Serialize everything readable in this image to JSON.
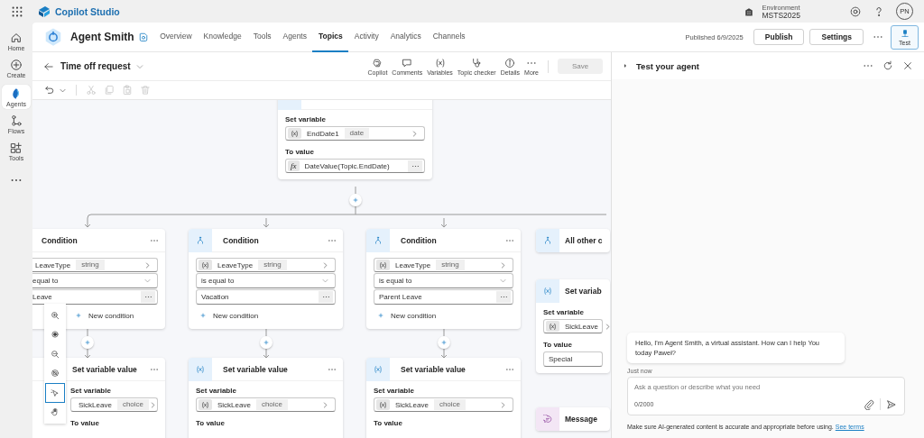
{
  "top_bar": {
    "app_name": "Copilot Studio",
    "environment_label": "Environment",
    "environment": "MSTS2025",
    "avatar": "PN"
  },
  "rail": [
    {
      "kind": "home",
      "label": "Home",
      "selected": false
    },
    {
      "kind": "create",
      "label": "Create",
      "selected": false
    },
    {
      "kind": "agents",
      "label": "Agents",
      "selected": true
    },
    {
      "kind": "flows",
      "label": "Flows",
      "selected": false
    },
    {
      "kind": "tools",
      "label": "Tools",
      "selected": false
    },
    {
      "kind": "more"
    }
  ],
  "agent": {
    "name": "Agent Smith"
  },
  "tabs": [
    {
      "label": "Overview",
      "selected": false
    },
    {
      "label": "Knowledge",
      "selected": false
    },
    {
      "label": "Tools",
      "selected": false
    },
    {
      "label": "Agents",
      "selected": false
    },
    {
      "label": "Topics",
      "selected": true
    },
    {
      "label": "Activity",
      "selected": false
    },
    {
      "label": "Analytics",
      "selected": false
    },
    {
      "label": "Channels",
      "selected": false
    }
  ],
  "published": "Published 6/9/2025",
  "header_buttons": [
    {
      "label": "Publish"
    },
    {
      "label": "Settings"
    }
  ],
  "test_button": {
    "label": "Test",
    "selected": true
  },
  "topic": {
    "title": "Time off request"
  },
  "topic_tools": [
    {
      "kind": "copilot",
      "label": "Copilot"
    },
    {
      "kind": "comments",
      "label": "Comments"
    },
    {
      "kind": "variables",
      "label": "Variables"
    },
    {
      "kind": "checker",
      "label": "Topic checker"
    },
    {
      "kind": "details",
      "label": "Details"
    },
    {
      "kind": "more",
      "label": "More"
    }
  ],
  "save": {
    "label": "Save",
    "disabled": true
  },
  "edit_tools": [
    {
      "kind": "cut",
      "disabled": true
    },
    {
      "kind": "copy",
      "disabled": true
    },
    {
      "kind": "paste",
      "disabled": true
    },
    {
      "kind": "delete",
      "disabled": true
    }
  ],
  "canvas": {
    "top_node": {
      "set_variable_label": "Set variable",
      "variable": "EndDate1",
      "type": "date",
      "to_value_label": "To value",
      "formula_icon": "fx",
      "formula": "DateValue(Topic.EndDate)"
    },
    "branches": [
      {
        "kind": "partial",
        "title": "Condition",
        "variable": "LeaveType",
        "type": "string",
        "operator": "equal to",
        "value": "Leave",
        "add_label": "New condition",
        "next": {
          "title": "Set variable value",
          "set_variable_label": "Set variable",
          "variable": "SickLeave",
          "type": "choice",
          "to_value_label": "To value"
        }
      },
      {
        "kind": "full",
        "title": "Condition",
        "variable": "LeaveType",
        "type": "string",
        "operator": "is equal to",
        "value": "Vacation",
        "add_label": "New condition",
        "next": {
          "title": "Set variable value",
          "set_variable_label": "Set variable",
          "variable": "SickLeave",
          "type": "choice",
          "to_value_label": "To value"
        }
      },
      {
        "kind": "full",
        "title": "Condition",
        "variable": "LeaveType",
        "type": "string",
        "operator": "is equal to",
        "value": "Parent Leave",
        "add_label": "New condition",
        "next": {
          "title": "Set variable value",
          "set_variable_label": "Set variable",
          "variable": "SickLeave",
          "type": "choice",
          "to_value_label": "To value"
        }
      }
    ],
    "other_branch": {
      "title": "All other c",
      "next": {
        "title": "Set variab",
        "set_variable_label": "Set variable",
        "variable": "SickLeave",
        "to_value_label": "To value",
        "value": "Special"
      },
      "message": {
        "title": "Message"
      }
    },
    "zoom_tools": [
      {
        "kind": "zoom-in",
        "selected": false
      },
      {
        "kind": "center",
        "selected": false
      },
      {
        "kind": "zoom-out",
        "selected": false
      },
      {
        "kind": "minimap",
        "selected": false
      },
      {
        "kind": "select",
        "selected": true
      },
      {
        "kind": "pan",
        "selected": false
      }
    ]
  },
  "test_panel": {
    "title": "Test your agent",
    "message": "Hello, I'm Agent Smith, a virtual assistant. How can I help You today Paweł?",
    "time": "Just now",
    "input": {
      "placeholder": "Ask a question or describe what you need",
      "counter": "0/2000"
    },
    "disclaimer": "Make sure AI-generated content is accurate and appropriate before using.",
    "terms_link": "See terms"
  }
}
